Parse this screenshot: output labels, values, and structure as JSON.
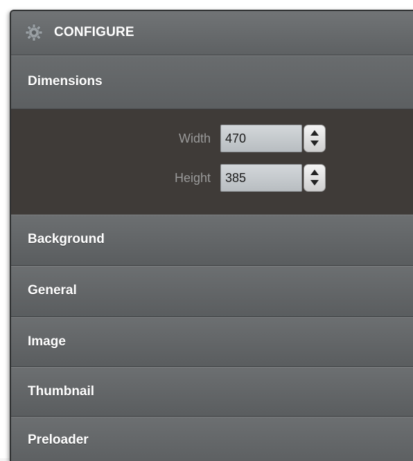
{
  "header": {
    "title": "CONFIGURE",
    "icon": "gear-icon"
  },
  "sections": {
    "dimensions": {
      "label": "Dimensions",
      "width_label": "Width",
      "width_value": "470",
      "height_label": "Height",
      "height_value": "385"
    },
    "background": {
      "label": "Background"
    },
    "general": {
      "label": "General"
    },
    "image": {
      "label": "Image"
    },
    "thumbnail": {
      "label": "Thumbnail"
    },
    "preloader": {
      "label": "Preloader"
    }
  },
  "colors": {
    "panel": "#5f6264",
    "header": "#6b6e70",
    "dimensions_body": "#3f3b38",
    "input_bg": "#c6cbcf",
    "label_text": "#ffffff",
    "field_label_text": "#9a9a9a"
  }
}
